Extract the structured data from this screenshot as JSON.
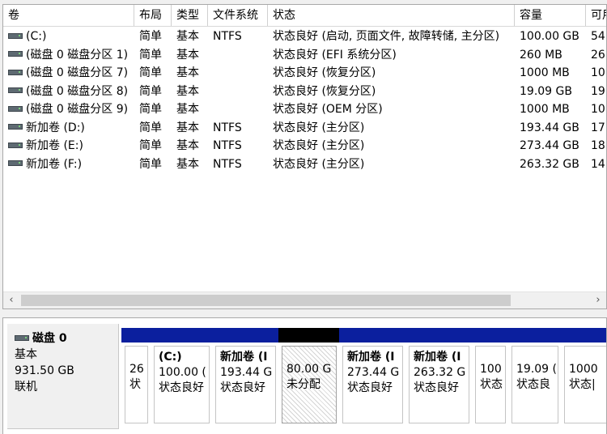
{
  "columns": [
    "卷",
    "布局",
    "类型",
    "文件系统",
    "状态",
    "容量",
    "可用"
  ],
  "volumes": [
    {
      "name": "(C:)",
      "layout": "简单",
      "type": "基本",
      "fs": "NTFS",
      "status": "状态良好 (启动, 页面文件, 故障转储, 主分区)",
      "capacity": "100.00 GB",
      "free": "54"
    },
    {
      "name": "(磁盘 0 磁盘分区 1)",
      "layout": "简单",
      "type": "基本",
      "fs": "",
      "status": "状态良好 (EFI 系统分区)",
      "capacity": "260 MB",
      "free": "26"
    },
    {
      "name": "(磁盘 0 磁盘分区 7)",
      "layout": "简单",
      "type": "基本",
      "fs": "",
      "status": "状态良好 (恢复分区)",
      "capacity": "1000 MB",
      "free": "10"
    },
    {
      "name": "(磁盘 0 磁盘分区 8)",
      "layout": "简单",
      "type": "基本",
      "fs": "",
      "status": "状态良好 (恢复分区)",
      "capacity": "19.09 GB",
      "free": "19"
    },
    {
      "name": "(磁盘 0 磁盘分区 9)",
      "layout": "简单",
      "type": "基本",
      "fs": "",
      "status": "状态良好 (OEM 分区)",
      "capacity": "1000 MB",
      "free": "10"
    },
    {
      "name": "新加卷 (D:)",
      "layout": "简单",
      "type": "基本",
      "fs": "NTFS",
      "status": "状态良好 (主分区)",
      "capacity": "193.44 GB",
      "free": "17"
    },
    {
      "name": "新加卷 (E:)",
      "layout": "简单",
      "type": "基本",
      "fs": "NTFS",
      "status": "状态良好 (主分区)",
      "capacity": "273.44 GB",
      "free": "18"
    },
    {
      "name": "新加卷 (F:)",
      "layout": "简单",
      "type": "基本",
      "fs": "NTFS",
      "status": "状态良好 (主分区)",
      "capacity": "263.32 GB",
      "free": "14"
    }
  ],
  "scroll": {
    "left_arrow": "‹",
    "right_arrow": "›"
  },
  "disk": {
    "name": "磁盘 0",
    "type": "基本",
    "size": "931.50 GB",
    "state": "联机"
  },
  "partitions": [
    {
      "lines": [
        "26",
        "状"
      ],
      "bold_first": false,
      "unallocated": false
    },
    {
      "lines": [
        "(C:)",
        "100.00 (",
        "状态良好"
      ],
      "bold_first": true,
      "unallocated": false
    },
    {
      "lines": [
        "新加卷 (I",
        "193.44 G",
        "状态良好"
      ],
      "bold_first": true,
      "unallocated": false
    },
    {
      "lines": [
        "80.00 G",
        "未分配"
      ],
      "bold_first": false,
      "unallocated": true
    },
    {
      "lines": [
        "新加卷 (I",
        "273.44 G",
        "状态良好"
      ],
      "bold_first": true,
      "unallocated": false
    },
    {
      "lines": [
        "新加卷 (I",
        "263.32 G",
        "状态良好"
      ],
      "bold_first": true,
      "unallocated": false
    },
    {
      "lines": [
        "100",
        "状态"
      ],
      "bold_first": false,
      "unallocated": false
    },
    {
      "lines": [
        "19.09 (",
        "状态良"
      ],
      "bold_first": false,
      "unallocated": false
    },
    {
      "lines": [
        "1000",
        "状态|"
      ],
      "bold_first": false,
      "unallocated": false
    }
  ],
  "colors": {
    "partition_bar": "#0b1f9e",
    "unallocated_bar": "#000000"
  }
}
